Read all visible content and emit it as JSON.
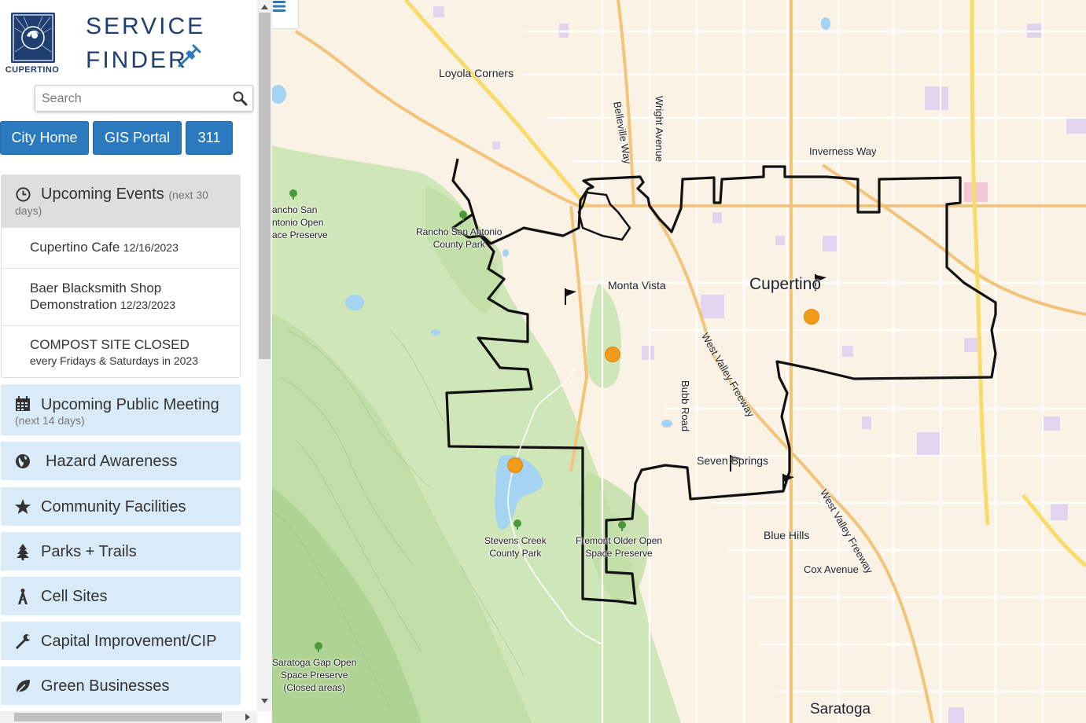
{
  "sidebar": {
    "logo_text": "CUPERTINO",
    "title_line1": "SERVICE",
    "title_line2": "FINDER",
    "search": {
      "placeholder": "Search",
      "value": ""
    },
    "nav_buttons": [
      {
        "label": "City Home"
      },
      {
        "label": "GIS Portal"
      },
      {
        "label": "311"
      }
    ],
    "events": {
      "title": "Upcoming Events",
      "subtitle_part1": "(next 30",
      "subtitle_part2": "days)",
      "items": [
        {
          "name": "Cupertino Cafe",
          "date": "12/16/2023"
        },
        {
          "name_line1": "Baer Blacksmith Shop",
          "name_line2": "Demonstration",
          "date": "12/23/2023"
        },
        {
          "name": "COMPOST SITE CLOSED",
          "detail": "every Fridays & Saturdays in 2023"
        }
      ]
    },
    "meeting": {
      "title": "Upcoming Public Meeting",
      "subtitle": "(next 14 days)"
    },
    "layers": [
      {
        "label": "Hazard Awareness",
        "icon": "globe-icon"
      },
      {
        "label": "Community Facilities",
        "icon": "star-icon"
      },
      {
        "label": "Parks + Trails",
        "icon": "tree-icon"
      },
      {
        "label": "Cell Sites",
        "icon": "antenna-icon"
      },
      {
        "label": "Capital Improvement/CIP",
        "icon": "wrench-icon"
      },
      {
        "label": "Green Businesses",
        "icon": "leaf-icon"
      }
    ]
  },
  "map": {
    "labels": {
      "loyola": "Loyola Corners",
      "belleville": "Belleville Way",
      "wright": "Wright Avenue",
      "inverness": "Inverness Way",
      "rancho_left_1": "ancho San",
      "rancho_left_2": "ntonio Open",
      "rancho_left_3": "ace Preserve",
      "rancho_park_1": "Rancho San Antonio",
      "rancho_park_2": "County Park",
      "monta_vista": "Monta Vista",
      "cupertino": "Cupertino",
      "west_valley_1": "West Valley Freeway",
      "bubb": "Bubb Road",
      "seven_springs": "Seven Springs",
      "west_valley_2": "West Valley Freeway",
      "stevens_1": "Stevens Creek",
      "stevens_2": "County Park",
      "fremont_1": "Fremont Older Open",
      "fremont_2": "Space Preserve",
      "blue_hills": "Blue Hills",
      "cox": "Cox Avenue",
      "saratoga_gap_1": "Saratoga Gap Open",
      "saratoga_gap_2": "Space Preserve",
      "saratoga_gap_3": "(Closed areas)",
      "saratoga": "Saratoga"
    },
    "colors": {
      "background": "#fbf2e6",
      "park_green": "#cfe6b8",
      "dark_green": "#a9cf8d",
      "water": "#a5d3f2",
      "highway": "#f2c47a",
      "freeway": "#f7dc6a",
      "boundary": "#111111",
      "poi": "#f29a1a",
      "street": "#ffffff"
    }
  },
  "colors": {
    "accent": "#2b7ac0",
    "panel_light": "#d9eaf8",
    "header_gray": "#dedede",
    "logo_blue": "#1f3f73"
  }
}
